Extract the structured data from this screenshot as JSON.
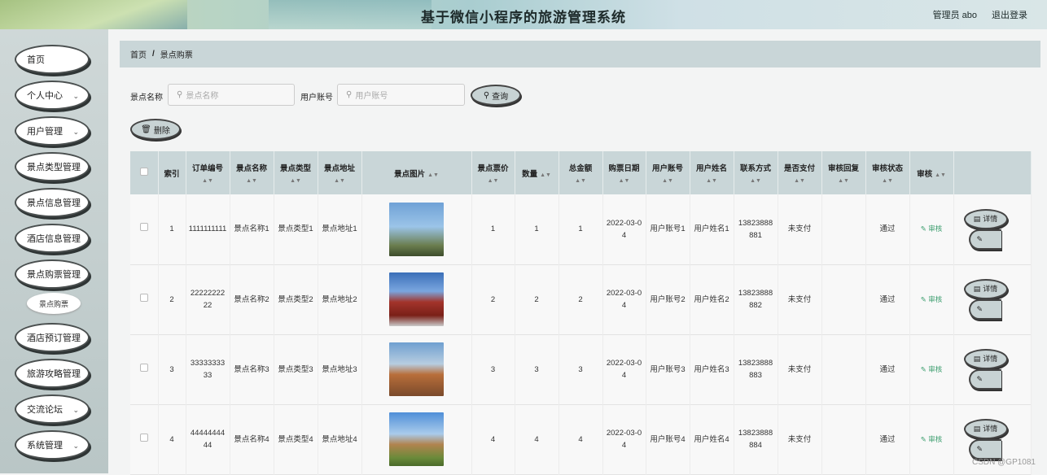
{
  "header": {
    "title": "基于微信小程序的旅游管理系统",
    "user": "管理员 abo",
    "logout": "退出登录"
  },
  "sidebar": {
    "items": [
      {
        "label": "首页",
        "chevron": false
      },
      {
        "label": "个人中心",
        "chevron": true
      },
      {
        "label": "用户管理",
        "chevron": true
      },
      {
        "label": "景点类型管理",
        "chevron": false
      },
      {
        "label": "景点信息管理",
        "chevron": false
      },
      {
        "label": "酒店信息管理",
        "chevron": false
      },
      {
        "label": "景点购票管理",
        "chevron": false
      },
      {
        "label": "酒店预订管理",
        "chevron": false
      },
      {
        "label": "旅游攻略管理",
        "chevron": false
      },
      {
        "label": "交流论坛",
        "chevron": true
      },
      {
        "label": "系统管理",
        "chevron": true
      }
    ],
    "subitem": "景点购票"
  },
  "breadcrumb": {
    "home": "首页",
    "sep": "/",
    "current": "景点购票"
  },
  "search": {
    "label1": "景点名称",
    "placeholder1": "景点名称",
    "label2": "用户账号",
    "placeholder2": "用户账号",
    "query": "查询",
    "delete": "删除"
  },
  "table": {
    "headers": [
      "索引",
      "订单编号",
      "景点名称",
      "景点类型",
      "景点地址",
      "景点图片",
      "景点票价",
      "数量",
      "总金额",
      "购票日期",
      "用户账号",
      "用户姓名",
      "联系方式",
      "是否支付",
      "审核回复",
      "审核状态",
      "审核"
    ],
    "audit_label": "审核",
    "detail_label": "详情",
    "rows": [
      {
        "idx": "1",
        "order": "1111111111",
        "name": "景点名称1",
        "type": "景点类型1",
        "addr": "景点地址1",
        "price": "1",
        "qty": "1",
        "total": "1",
        "date": "2022-03-04",
        "account": "用户账号1",
        "uname": "用户姓名1",
        "phone": "13823888881",
        "paid": "未支付",
        "reply": "",
        "status": "通过"
      },
      {
        "idx": "2",
        "order": "2222222222",
        "name": "景点名称2",
        "type": "景点类型2",
        "addr": "景点地址2",
        "price": "2",
        "qty": "2",
        "total": "2",
        "date": "2022-03-04",
        "account": "用户账号2",
        "uname": "用户姓名2",
        "phone": "13823888882",
        "paid": "未支付",
        "reply": "",
        "status": "通过"
      },
      {
        "idx": "3",
        "order": "3333333333",
        "name": "景点名称3",
        "type": "景点类型3",
        "addr": "景点地址3",
        "price": "3",
        "qty": "3",
        "total": "3",
        "date": "2022-03-04",
        "account": "用户账号3",
        "uname": "用户姓名3",
        "phone": "13823888883",
        "paid": "未支付",
        "reply": "",
        "status": "通过"
      },
      {
        "idx": "4",
        "order": "4444444444",
        "name": "景点名称4",
        "type": "景点类型4",
        "addr": "景点地址4",
        "price": "4",
        "qty": "4",
        "total": "4",
        "date": "2022-03-04",
        "account": "用户账号4",
        "uname": "用户姓名4",
        "phone": "13823888884",
        "paid": "未支付",
        "reply": "",
        "status": "通过"
      }
    ]
  },
  "watermark": "CSDN @GP1081"
}
